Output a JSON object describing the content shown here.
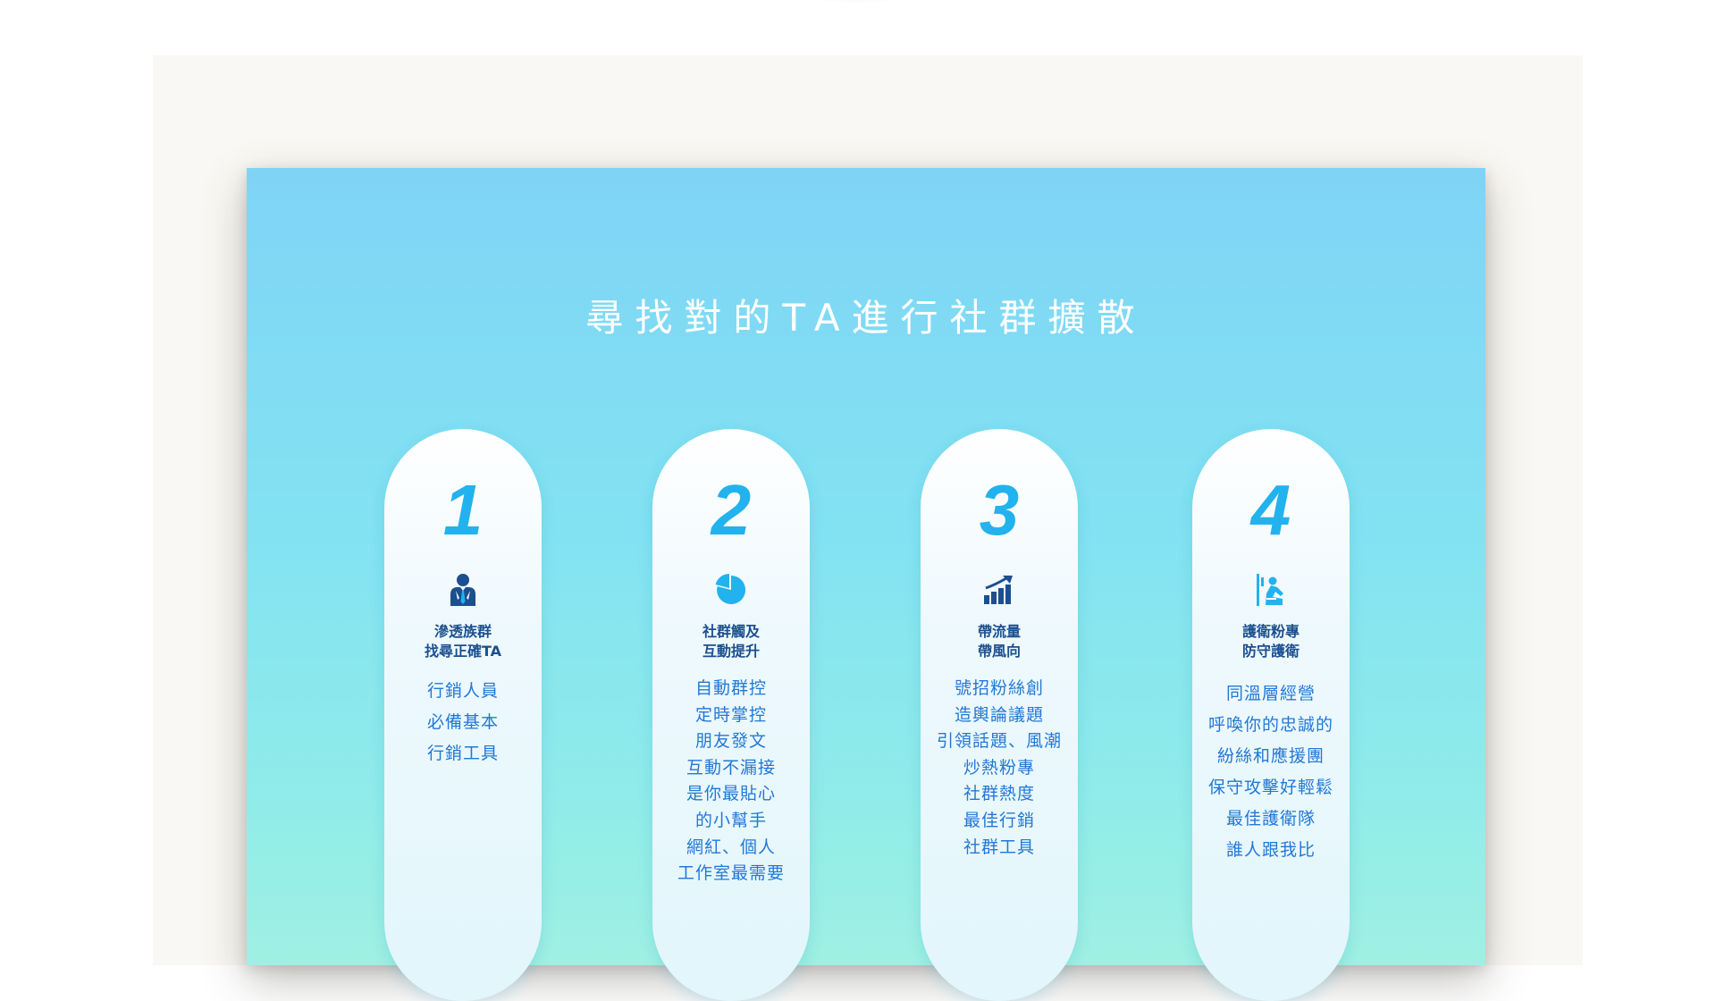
{
  "poster": {
    "title": "尋找對的TA進行社群擴散",
    "accent_color": "#22b2ee",
    "heading_color": "#1c4f8e",
    "body_color": "#2378d6"
  },
  "steps": [
    {
      "number": "1",
      "icon": "businessman-icon",
      "heading": [
        "滲透族群",
        "找尋正確TA"
      ],
      "body": [
        "行銷人員",
        "必備基本",
        "行銷工具"
      ]
    },
    {
      "number": "2",
      "icon": "pie-chart-icon",
      "heading": [
        "社群觸及",
        "互動提升"
      ],
      "body": [
        "自動群控",
        "定時掌控",
        "朋友發文",
        "互動不漏接",
        "是你最貼心",
        "的小幫手",
        "網紅、個人",
        "工作室最需要"
      ]
    },
    {
      "number": "3",
      "icon": "growth-chart-icon",
      "heading": [
        "帶流量",
        "帶風向"
      ],
      "body": [
        "號招粉絲創",
        "造輿論議題",
        "引領話題、風潮",
        "炒熱粉專",
        "社群熱度",
        "最佳行銷",
        "社群工具"
      ]
    },
    {
      "number": "4",
      "icon": "guard-icon",
      "heading": [
        "護衛粉專",
        "防守護衛"
      ],
      "body": [
        "同溫層經營",
        "呼喚你的忠誠的",
        "紛絲和應援團",
        "保守攻擊好輕鬆",
        "最佳護衛隊",
        "誰人跟我比"
      ]
    }
  ]
}
